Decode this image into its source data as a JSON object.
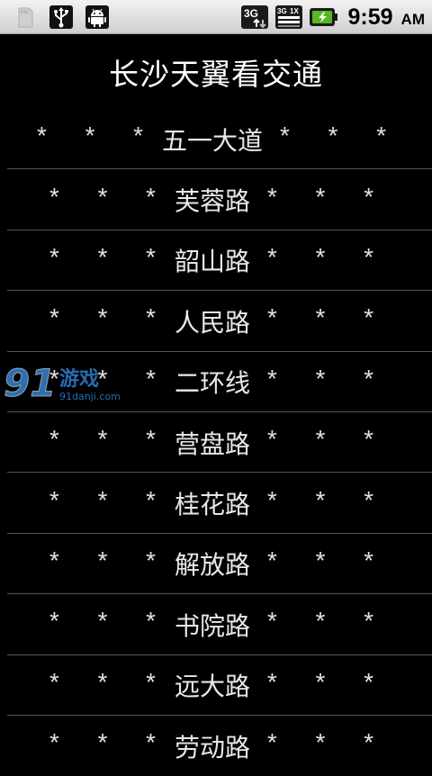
{
  "status_bar": {
    "left_icons": [
      "sdcard-icon",
      "usb-icon",
      "android-debug-icon"
    ],
    "right_icons": [
      "network-3g-icon",
      "signal-3g-1x-icon",
      "battery-charging-icon"
    ],
    "time": "9:59",
    "ampm": "AM"
  },
  "app": {
    "title": "长沙天翼看交通"
  },
  "roads": [
    {
      "prefix": "* * *",
      "name": "五一大道",
      "suffix": "* *  *"
    },
    {
      "prefix": "* * *",
      "name": "芙蓉路",
      "suffix": "* *  *"
    },
    {
      "prefix": "* * *",
      "name": "韶山路",
      "suffix": "* *  *"
    },
    {
      "prefix": "* * *",
      "name": "人民路",
      "suffix": "* *  *"
    },
    {
      "prefix": "* * *",
      "name": "二环线",
      "suffix": "* *  *"
    },
    {
      "prefix": "* * *",
      "name": "营盘路",
      "suffix": "* *  *"
    },
    {
      "prefix": "* * *",
      "name": "桂花路",
      "suffix": "* *  *"
    },
    {
      "prefix": "* * *",
      "name": "解放路",
      "suffix": "* *  *"
    },
    {
      "prefix": "* * *",
      "name": "书院路",
      "suffix": "* *  *"
    },
    {
      "prefix": "* * *",
      "name": "远大路",
      "suffix": "* *  *"
    },
    {
      "prefix": "* * *",
      "name": "劳动路",
      "suffix": "* *  *"
    }
  ],
  "watermark": {
    "logo": "91",
    "text": "游戏",
    "site": "91danji.com"
  },
  "colors": {
    "background": "#000000",
    "status_bar": "#e0e0e0",
    "text": "#ffffff",
    "divider": "#555555",
    "watermark_blue": "#2e7fd0"
  }
}
